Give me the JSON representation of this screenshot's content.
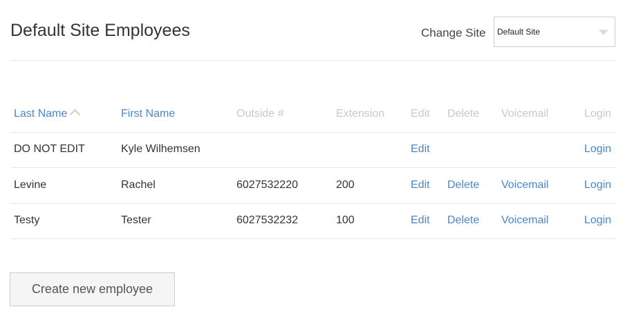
{
  "header": {
    "title": "Default Site Employees",
    "change_site_label": "Change Site",
    "site_selected": "Default Site"
  },
  "table": {
    "columns": [
      "Last Name",
      "First Name",
      "Outside #",
      "Extension",
      "Edit",
      "Delete",
      "Voicemail",
      "Login"
    ],
    "rows": [
      {
        "last": "DO NOT EDIT",
        "first": "Kyle Wilhemsen",
        "outside": "",
        "ext": "",
        "edit": "Edit",
        "delete": "",
        "voicemail": "",
        "login": "Login"
      },
      {
        "last": "Levine",
        "first": "Rachel",
        "outside": "6027532220",
        "ext": "200",
        "edit": "Edit",
        "delete": "Delete",
        "voicemail": "Voicemail",
        "login": "Login"
      },
      {
        "last": "Testy",
        "first": "Tester",
        "outside": "6027532232",
        "ext": "100",
        "edit": "Edit",
        "delete": "Delete",
        "voicemail": "Voicemail",
        "login": "Login"
      }
    ]
  },
  "create_button": "Create new employee"
}
